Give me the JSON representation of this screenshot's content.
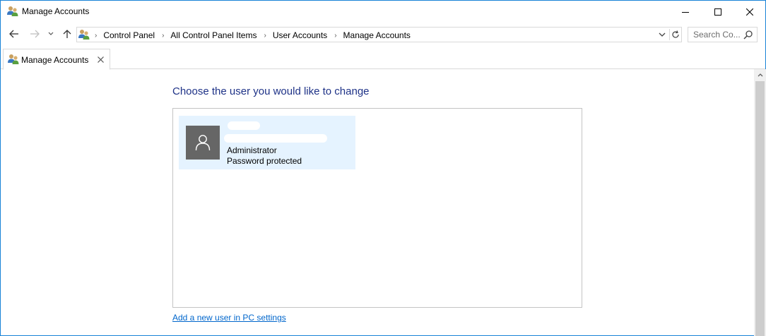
{
  "window": {
    "title": "Manage Accounts"
  },
  "address_bar": {
    "breadcrumbs": [
      "Control Panel",
      "All Control Panel Items",
      "User Accounts",
      "Manage Accounts"
    ]
  },
  "search": {
    "placeholder": "Search Co..."
  },
  "tab": {
    "label": "Manage Accounts"
  },
  "content": {
    "heading": "Choose the user you would like to change",
    "users": [
      {
        "role": "Administrator",
        "status": "Password protected"
      }
    ],
    "add_user_link": "Add a new user in PC settings"
  },
  "colors": {
    "heading": "#1e3287",
    "link": "#0066cc",
    "tile_bg": "#e5f3ff",
    "avatar_bg": "#666666",
    "window_border": "#1883d7"
  },
  "icons": {
    "app": "user-accounts-icon",
    "avatar": "person-icon"
  }
}
